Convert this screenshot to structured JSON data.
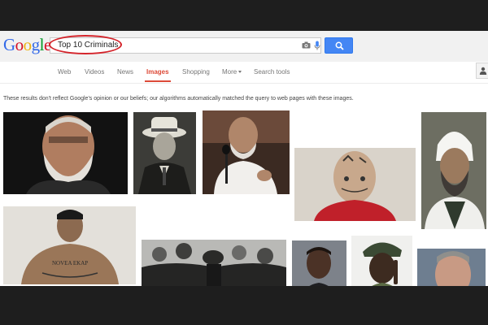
{
  "logo": {
    "letters": [
      "G",
      "o",
      "o",
      "g",
      "l",
      "e"
    ],
    "colors": [
      "#3369e8",
      "#d50f25",
      "#eeb211",
      "#3369e8",
      "#009925",
      "#d50f25"
    ]
  },
  "search": {
    "query": "Top 10 Criminals"
  },
  "nav": {
    "items": [
      "Web",
      "Videos",
      "News",
      "Images",
      "Shopping",
      "More",
      "Search tools"
    ],
    "active": "Images"
  },
  "disclaimer": "These results don't reflect Google's opinion or our beliefs; our algorithms automatically matched the query to web pages with these images.",
  "results": {
    "row1": [
      {
        "name": "result-image-1",
        "subject": "grey-bearded man portrait"
      },
      {
        "name": "result-image-2",
        "subject": "man in fedora and suit"
      },
      {
        "name": "result-image-3",
        "subject": "man speaking at microphone"
      },
      {
        "name": "result-image-4",
        "subject": "tattooed shaved head man in red"
      },
      {
        "name": "result-image-5",
        "subject": "man in white turban"
      }
    ],
    "row2": [
      {
        "name": "result-image-6",
        "subject": "tattooed shirtless man"
      },
      {
        "name": "result-image-7",
        "subject": "black and white crowd photo"
      },
      {
        "name": "result-image-8",
        "subject": "mugshot"
      },
      {
        "name": "result-image-9",
        "subject": "man in green beret pointing"
      },
      {
        "name": "result-image-10",
        "subject": "man in suit"
      }
    ]
  },
  "colors": {
    "accent_red": "#dd4b39",
    "search_blue": "#4486f4",
    "oval_red": "#d4242b"
  }
}
